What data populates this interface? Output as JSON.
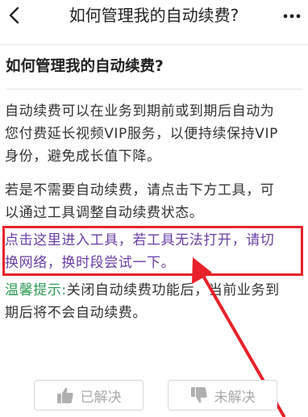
{
  "navbar": {
    "back_icon": "chevron-left-icon",
    "title": "如何管理我的自动续费?",
    "more_icon": "more-dots-icon"
  },
  "article": {
    "title": "如何管理我的自动续费?",
    "paragraph1": [
      "自动续费可以在业务到期前或到期后自动为",
      "您付费延长视频VIP服务，以便持续保持VIP",
      "身份，避免成长值下降。"
    ],
    "paragraph2": [
      "若是不需要自动续费，请点击下方工具，可",
      "以通过工具调整自动续费状态。"
    ],
    "link_lines": [
      "点击这里进入工具，若工具无法打开，请切",
      "换网络，换时段尝试一下。"
    ],
    "tip_label": "温馨提示:",
    "tip_line1": "关闭自动续费功能后，当前业务到",
    "tip_line2": "期后将不会自动续费。"
  },
  "feedback": {
    "resolved_label": "已解决",
    "resolved_icon": "thumbs-up-icon",
    "unresolved_label": "未解决",
    "unresolved_icon": "thumbs-down-icon"
  },
  "annotation": {
    "highlight_color": "#e8212a",
    "arrow_color": "#e8212a"
  },
  "colors": {
    "link": "#6a3fa6",
    "tip_label": "#2e9a55",
    "text": "#333333"
  }
}
